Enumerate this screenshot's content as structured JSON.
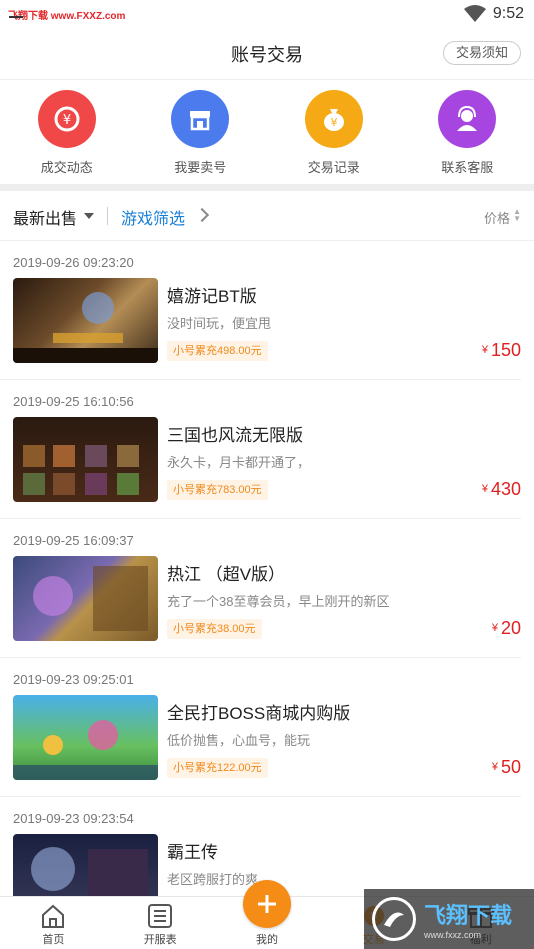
{
  "status": {
    "watermark": "飞翔下载 www.FXXZ.com",
    "time": "9:52"
  },
  "header": {
    "title": "账号交易",
    "notice_button": "交易须知"
  },
  "quick_actions": [
    {
      "label": "成交动态",
      "icon": "exchange-icon",
      "color": "#f04848"
    },
    {
      "label": "我要卖号",
      "icon": "shop-icon",
      "color": "#4b7bec"
    },
    {
      "label": "交易记录",
      "icon": "moneybag-icon",
      "color": "#f4a915"
    },
    {
      "label": "联系客服",
      "icon": "support-agent-icon",
      "color": "#a745e0"
    }
  ],
  "filter": {
    "latest": "最新出售",
    "game_filter": "游戏筛选",
    "price": "价格"
  },
  "listings": [
    {
      "date": "2019-09-26 09:23:20",
      "name": "嬉游记BT版",
      "desc": "没时间玩，便宜甩",
      "tag": "小号累充498.00元",
      "price": "150",
      "currency": "¥"
    },
    {
      "date": "2019-09-25 16:10:56",
      "name": "三国也风流无限版",
      "desc": "永久卡，月卡都开通了，",
      "tag": "小号累充783.00元",
      "price": "430",
      "currency": "¥"
    },
    {
      "date": "2019-09-25 16:09:37",
      "name": "热江 （超V版）",
      "desc": "充了一个38至尊会员，早上刚开的新区",
      "tag": "小号累充38.00元",
      "price": "20",
      "currency": "¥"
    },
    {
      "date": "2019-09-23 09:25:01",
      "name": "全民打BOSS商城内购版",
      "desc": "低价抛售，心血号，能玩",
      "tag": "小号累充122.00元",
      "price": "50",
      "currency": "¥"
    },
    {
      "date": "2019-09-23 09:23:54",
      "name": "霸王传",
      "desc": "老区跨服打的爽",
      "tag": "",
      "price": "",
      "currency": ""
    }
  ],
  "tabs": [
    {
      "label": "首页",
      "icon": "home-icon"
    },
    {
      "label": "开服表",
      "icon": "list-icon"
    },
    {
      "label": "我的",
      "icon": "add-icon"
    },
    {
      "label": "交易",
      "icon": "trade-icon"
    },
    {
      "label": "福利",
      "icon": "gift-icon"
    }
  ],
  "brand_watermark": {
    "title": "飞翔下载",
    "url": "www.fxxz.com"
  }
}
